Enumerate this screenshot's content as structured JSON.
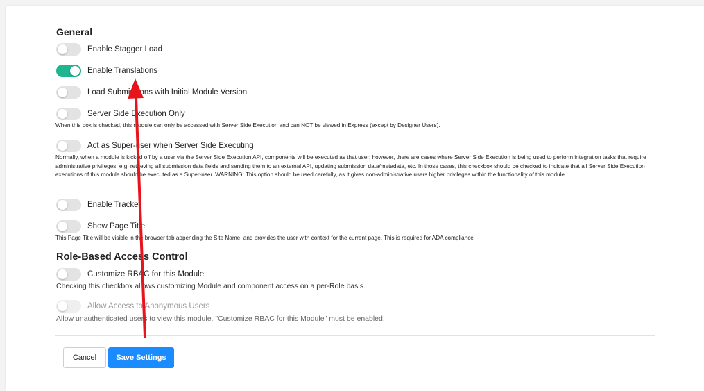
{
  "general": {
    "heading": "General",
    "toggles": [
      {
        "label": "Enable Stagger Load",
        "on": false
      },
      {
        "label": "Enable Translations",
        "on": true
      },
      {
        "label": "Load Submissions with Initial Module Version",
        "on": false
      },
      {
        "label": "Server Side Execution Only",
        "on": false,
        "help": "When this box is checked, this module can only be accessed with Server Side Execution and can NOT be viewed in Express (except by Designer Users)."
      },
      {
        "label": "Act as Super-user when Server Side Executing",
        "on": false,
        "help": "Normally, when a module is kicked off by a user via the Server Side Execution API, components will be executed as that user; however, there are cases where Server Side Execution is being used to perform integration tasks that require administrative privileges, e.g. retrieving all submission data fields and sending them to an external API, updating submission data/metadata, etc. In those cases, this checkbox should be checked to indicate that all Server Side Execution executions of this module should be executed as a Super-user. WARNING: This option should be used carefully, as it gives non-administrative users higher privileges within the functionality of this module."
      },
      {
        "label": "Enable Tracker",
        "on": false
      },
      {
        "label": "Show Page Title",
        "on": false,
        "help": "This Page Title will be visible in the browser tab appending the Site Name, and provides the user with context for the current page. This is required for ADA compliance"
      }
    ]
  },
  "rbac": {
    "heading": "Role-Based Access Control",
    "toggles": [
      {
        "label": "Customize RBAC for this Module",
        "on": false,
        "help": "Checking this checkbox allows customizing Module and component access on a per-Role basis."
      },
      {
        "label": "Allow Access to Anonymous Users",
        "on": false,
        "disabled": true,
        "help": "Allow unauthenticated users to view this module. \"Customize RBAC for this Module\" must be enabled."
      }
    ]
  },
  "actions": {
    "cancel_label": "Cancel",
    "save_label": "Save Settings"
  },
  "colors": {
    "toggle_on": "#1fb58f",
    "save_button": "#1a8cff",
    "annotation_arrow": "#e8141b"
  }
}
